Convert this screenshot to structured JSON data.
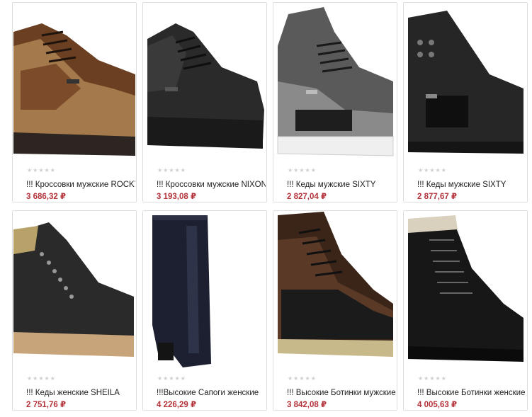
{
  "products": [
    {
      "title": "!!! Кроссовки мужские ROCKY-",
      "price": "3 686,32 ₽",
      "rating": 0,
      "image": "brown-sneaker"
    },
    {
      "title": "!!! Кроссовки мужские NIXON",
      "price": "3 193,08 ₽",
      "rating": 0,
      "image": "black-sneaker"
    },
    {
      "title": "!!! Кеды мужские SIXTY",
      "price": "2 827,04 ₽",
      "rating": 0,
      "image": "grey-sneaker-white-sole"
    },
    {
      "title": "!!! Кеды мужские SIXTY",
      "price": "2 877,67 ₽",
      "rating": 0,
      "image": "black-high-sneaker"
    },
    {
      "title": "!!! Кеды женские SHEILA",
      "price": "2 751,76 ₽",
      "rating": 0,
      "image": "black-sneaker-tan-sole"
    },
    {
      "title": "!!!Высокие Сапоги женские",
      "price": "4 226,29 ₽",
      "rating": 0,
      "image": "tall-boot"
    },
    {
      "title": "!!! Высокие Ботинки мужские",
      "price": "3 842,08 ₽",
      "rating": 0,
      "image": "brown-hiking-boot"
    },
    {
      "title": "!!! Высокие Ботинки женские",
      "price": "4 005,63 ₽",
      "rating": 0,
      "image": "black-winter-boot"
    }
  ],
  "colors": {
    "price": "#b5333a",
    "star_empty": "#cfcfcf",
    "border": "#dedede"
  }
}
